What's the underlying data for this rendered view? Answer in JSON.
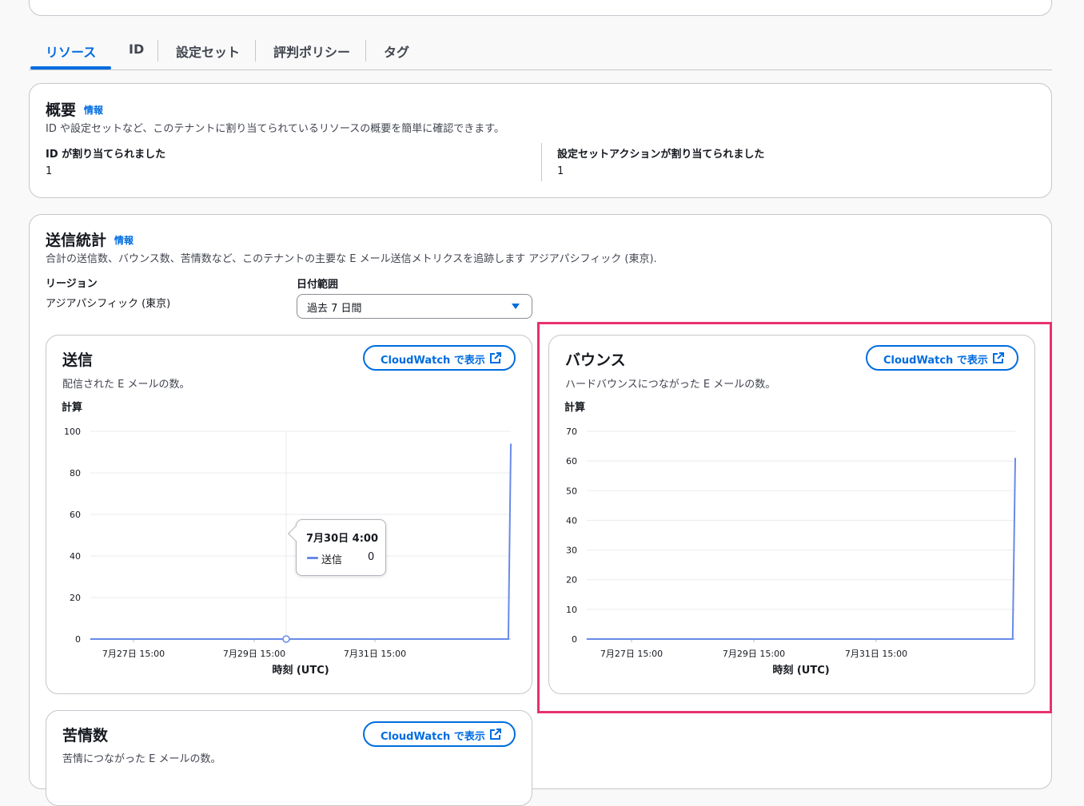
{
  "tabs": [
    {
      "label": "リソース",
      "active": true
    },
    {
      "label": "ID",
      "active": false
    },
    {
      "label": "設定セット",
      "active": false
    },
    {
      "label": "評判ポリシー",
      "active": false
    },
    {
      "label": "タグ",
      "active": false
    }
  ],
  "overview": {
    "title": "概要",
    "info": "情報",
    "description": "ID や設定セットなど、このテナントに割り当てられているリソースの概要を簡単に確認できます。",
    "stats": [
      {
        "label": "ID が割り当てられました",
        "value": "1"
      },
      {
        "label": "設定セットアクションが割り当てられました",
        "value": "1"
      }
    ]
  },
  "sending_stats": {
    "title": "送信統計",
    "info": "情報",
    "description": "合計の送信数、バウンス数、苦情数など、このテナントの主要な E メール送信メトリクスを追跡します アジアパシフィック (東京).",
    "region_label": "リージョン",
    "region_value": "アジアパシフィック (東京)",
    "date_range_label": "日付範囲",
    "date_range_value": "過去 7 日間"
  },
  "cloudwatch_button": "CloudWatch で表示",
  "charts": {
    "send": {
      "title": "送信",
      "description": "配信された E メールの数。"
    },
    "bounce": {
      "title": "バウンス",
      "description": "ハードバウンスにつながった E メールの数。"
    },
    "complaint": {
      "title": "苦情数",
      "description": "苦情につながった E メールの数。"
    }
  },
  "tooltip": {
    "date": "7月30日 4:00",
    "series": "送信",
    "value": "0"
  },
  "colors": {
    "accent": "#006ce0",
    "series": "#688ae8",
    "highlight": "#e8316e"
  },
  "chart_data": [
    {
      "type": "line",
      "title": "送信",
      "ylabel": "計算",
      "xlabel": "時刻 (UTC)",
      "ylim": [
        0,
        100
      ],
      "yticks": [
        "0",
        "20",
        "40",
        "60",
        "80",
        "100"
      ],
      "xticks": [
        "7月27日 15:00",
        "7月29日 15:00",
        "7月31日 15:00"
      ],
      "series": [
        {
          "name": "送信",
          "x": [
            "2025-07-26T01:00",
            "2025-08-01T23:00",
            "2025-08-02T00:00"
          ],
          "values": [
            0,
            0,
            94
          ]
        }
      ]
    },
    {
      "type": "line",
      "title": "バウンス",
      "ylabel": "計算",
      "xlabel": "時刻 (UTC)",
      "ylim": [
        0,
        70
      ],
      "yticks": [
        "0",
        "10",
        "20",
        "30",
        "40",
        "50",
        "60",
        "70"
      ],
      "xticks": [
        "7月27日 15:00",
        "7月29日 15:00",
        "7月31日 15:00"
      ],
      "series": [
        {
          "x": [
            "2025-07-26T01:00",
            "2025-08-01T23:00",
            "2025-08-02T00:00"
          ],
          "values": [
            0,
            0,
            61
          ]
        }
      ]
    }
  ]
}
